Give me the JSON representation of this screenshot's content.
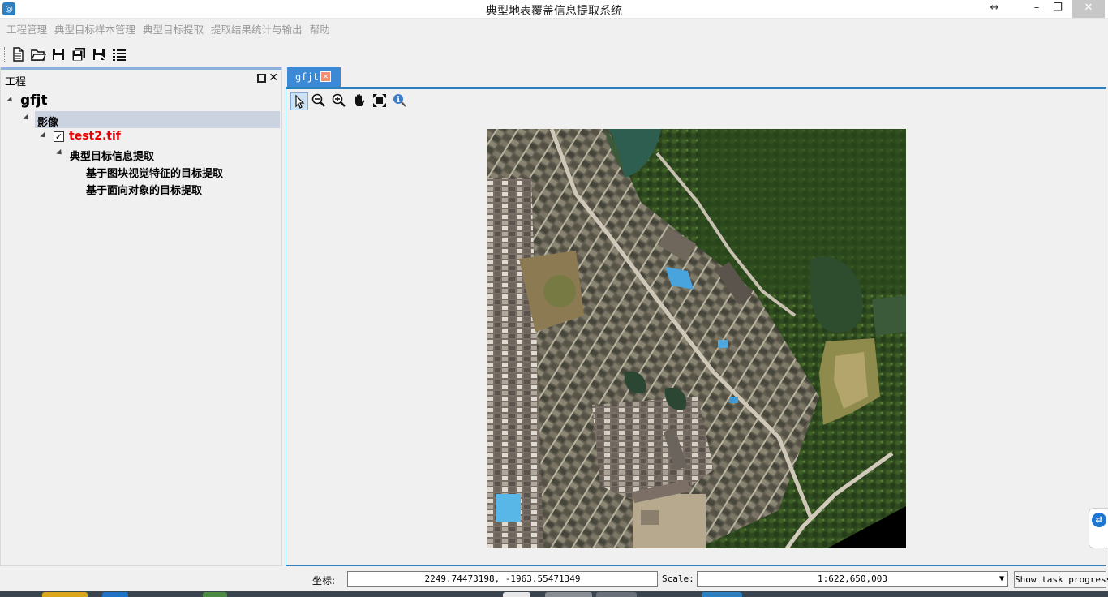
{
  "window": {
    "title": "典型地表覆盖信息提取系统"
  },
  "menu": {
    "items": [
      "工程管理",
      "典型目标样本管理",
      "典型目标提取",
      "提取结果统计与输出",
      "帮助"
    ]
  },
  "toolbar": {
    "buttons": [
      {
        "name": "new-file-icon"
      },
      {
        "name": "open-folder-icon"
      },
      {
        "name": "save-icon"
      },
      {
        "name": "save-all-icon"
      },
      {
        "name": "save-as-icon"
      },
      {
        "name": "list-icon"
      }
    ]
  },
  "project_panel": {
    "title": "工程",
    "tree": {
      "root": "gfjt",
      "group": "影像",
      "image_file": "test2.tif",
      "image_checked": true,
      "sub_group": "典型目标信息提取",
      "methods": [
        "基于图块视觉特征的目标提取",
        "基于面向对象的目标提取"
      ]
    }
  },
  "map": {
    "tab_label": "gfjt",
    "tools": [
      "select-arrow-icon",
      "zoom-out-icon",
      "zoom-in-icon",
      "pan-hand-icon",
      "full-extent-icon",
      "identify-icon"
    ]
  },
  "statusbar": {
    "coord_label": "坐标:",
    "coord_value": "2249.74473198, -1963.55471349",
    "scale_label": "Scale:",
    "scale_value": "1:622,650,003",
    "progress_button": "Show task progress"
  },
  "colors": {
    "accent": "#2c7fc1",
    "tab_bg": "#3c8ad6",
    "image_file_text": "#e60000"
  }
}
